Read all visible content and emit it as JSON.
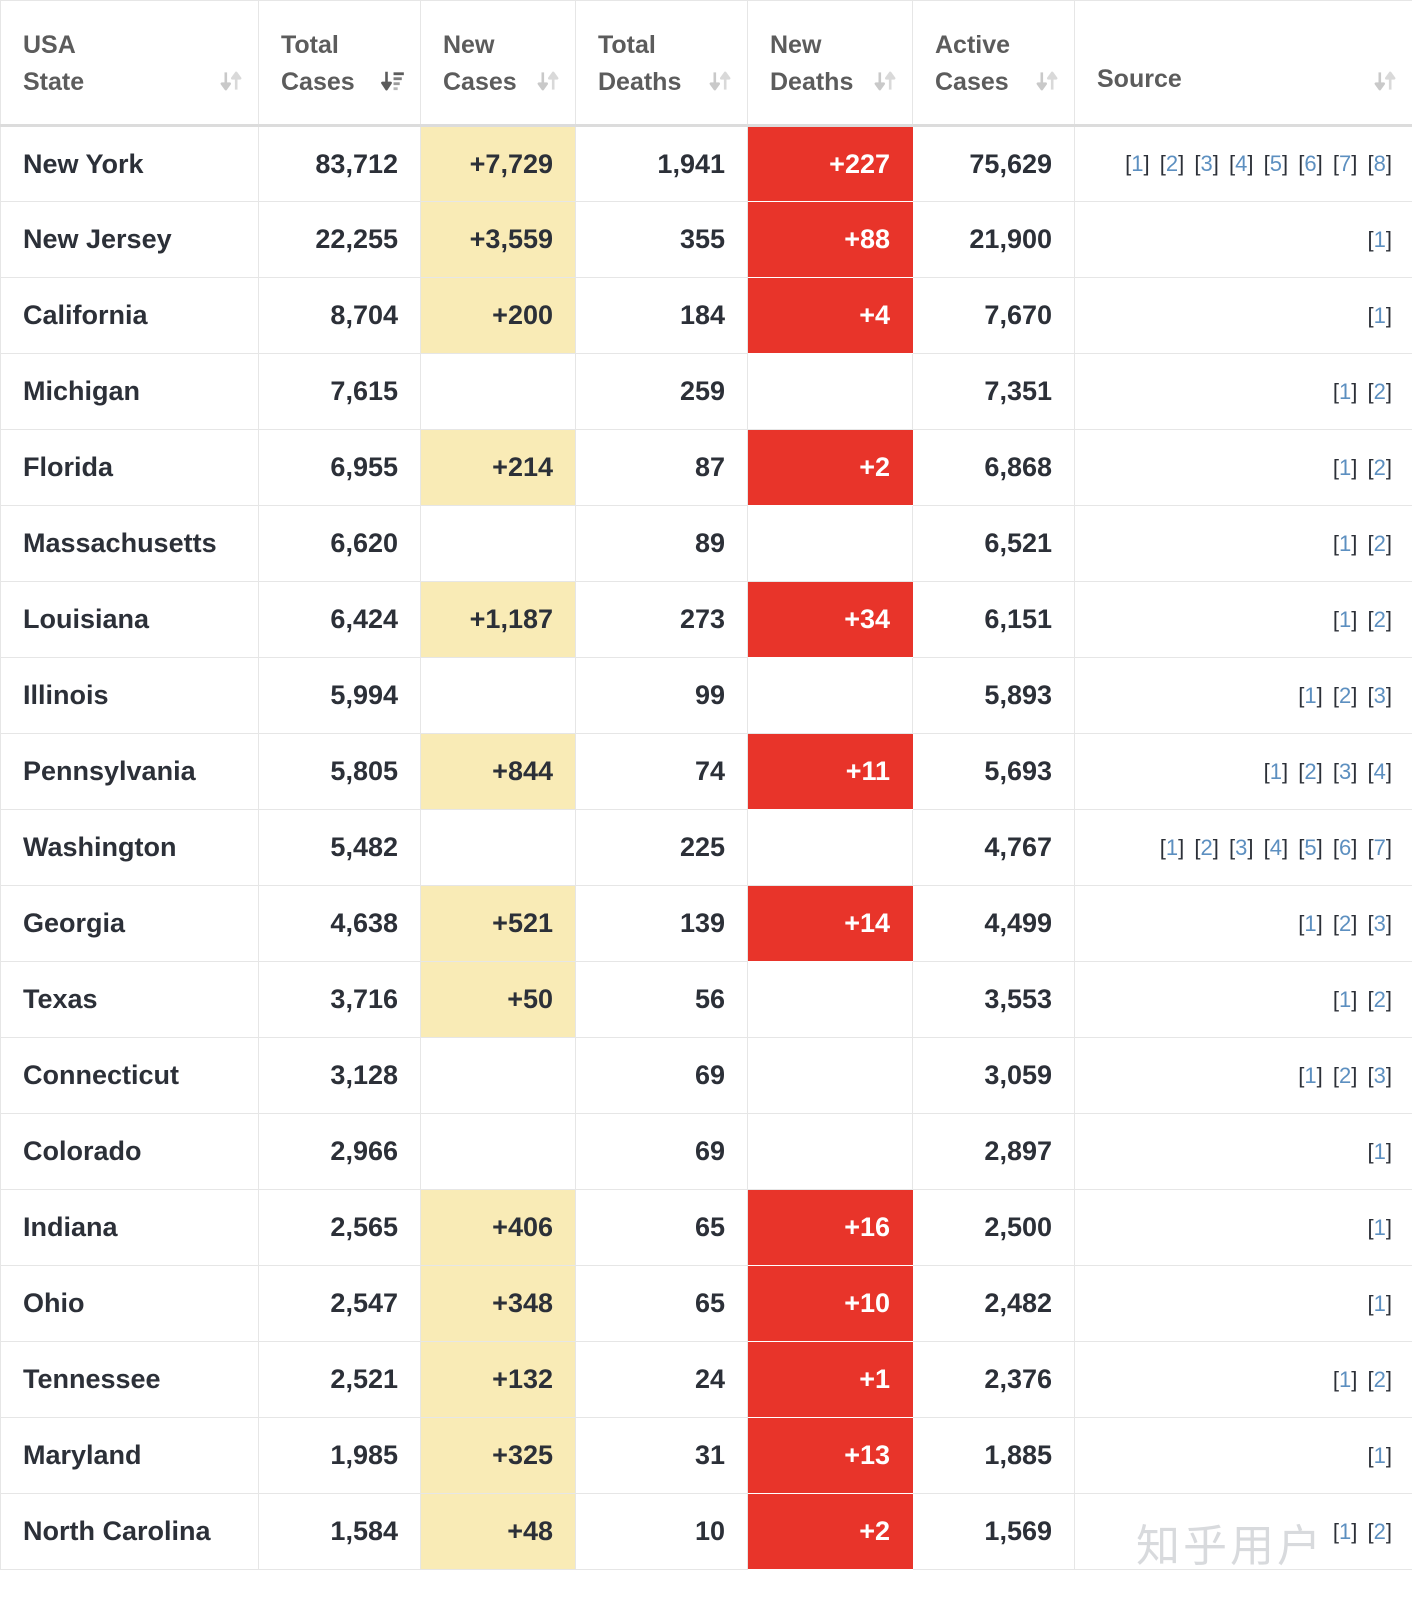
{
  "table": {
    "columns": [
      {
        "id": "state",
        "label_line1": "USA",
        "label_line2": "State",
        "sort_state": "none"
      },
      {
        "id": "total_cases",
        "label_line1": "Total",
        "label_line2": "Cases",
        "sort_state": "desc"
      },
      {
        "id": "new_cases",
        "label_line1": "New",
        "label_line2": "Cases",
        "sort_state": "none"
      },
      {
        "id": "total_deaths",
        "label_line1": "Total",
        "label_line2": "Deaths",
        "sort_state": "none"
      },
      {
        "id": "new_deaths",
        "label_line1": "New",
        "label_line2": "Deaths",
        "sort_state": "none"
      },
      {
        "id": "active_cases",
        "label_line1": "Active",
        "label_line2": "Cases",
        "sort_state": "none"
      },
      {
        "id": "source",
        "label_line1": "",
        "label_line2": "Source",
        "sort_state": "none"
      }
    ],
    "rows": [
      {
        "state": "New York",
        "total_cases": "83,712",
        "new_cases": "+7,729",
        "total_deaths": "1,941",
        "new_deaths": "+227",
        "active_cases": "75,629",
        "sources": [
          "1",
          "2",
          "3",
          "4",
          "5",
          "6",
          "7",
          "8"
        ]
      },
      {
        "state": "New Jersey",
        "total_cases": "22,255",
        "new_cases": "+3,559",
        "total_deaths": "355",
        "new_deaths": "+88",
        "active_cases": "21,900",
        "sources": [
          "1"
        ]
      },
      {
        "state": "California",
        "total_cases": "8,704",
        "new_cases": "+200",
        "total_deaths": "184",
        "new_deaths": "+4",
        "active_cases": "7,670",
        "sources": [
          "1"
        ]
      },
      {
        "state": "Michigan",
        "total_cases": "7,615",
        "new_cases": "",
        "total_deaths": "259",
        "new_deaths": "",
        "active_cases": "7,351",
        "sources": [
          "1",
          "2"
        ]
      },
      {
        "state": "Florida",
        "total_cases": "6,955",
        "new_cases": "+214",
        "total_deaths": "87",
        "new_deaths": "+2",
        "active_cases": "6,868",
        "sources": [
          "1",
          "2"
        ]
      },
      {
        "state": "Massachusetts",
        "total_cases": "6,620",
        "new_cases": "",
        "total_deaths": "89",
        "new_deaths": "",
        "active_cases": "6,521",
        "sources": [
          "1",
          "2"
        ]
      },
      {
        "state": "Louisiana",
        "total_cases": "6,424",
        "new_cases": "+1,187",
        "total_deaths": "273",
        "new_deaths": "+34",
        "active_cases": "6,151",
        "sources": [
          "1",
          "2"
        ]
      },
      {
        "state": "Illinois",
        "total_cases": "5,994",
        "new_cases": "",
        "total_deaths": "99",
        "new_deaths": "",
        "active_cases": "5,893",
        "sources": [
          "1",
          "2",
          "3"
        ]
      },
      {
        "state": "Pennsylvania",
        "total_cases": "5,805",
        "new_cases": "+844",
        "total_deaths": "74",
        "new_deaths": "+11",
        "active_cases": "5,693",
        "sources": [
          "1",
          "2",
          "3",
          "4"
        ]
      },
      {
        "state": "Washington",
        "total_cases": "5,482",
        "new_cases": "",
        "total_deaths": "225",
        "new_deaths": "",
        "active_cases": "4,767",
        "sources": [
          "1",
          "2",
          "3",
          "4",
          "5",
          "6",
          "7"
        ]
      },
      {
        "state": "Georgia",
        "total_cases": "4,638",
        "new_cases": "+521",
        "total_deaths": "139",
        "new_deaths": "+14",
        "active_cases": "4,499",
        "sources": [
          "1",
          "2",
          "3"
        ]
      },
      {
        "state": "Texas",
        "total_cases": "3,716",
        "new_cases": "+50",
        "total_deaths": "56",
        "new_deaths": "",
        "active_cases": "3,553",
        "sources": [
          "1",
          "2"
        ]
      },
      {
        "state": "Connecticut",
        "total_cases": "3,128",
        "new_cases": "",
        "total_deaths": "69",
        "new_deaths": "",
        "active_cases": "3,059",
        "sources": [
          "1",
          "2",
          "3"
        ]
      },
      {
        "state": "Colorado",
        "total_cases": "2,966",
        "new_cases": "",
        "total_deaths": "69",
        "new_deaths": "",
        "active_cases": "2,897",
        "sources": [
          "1"
        ]
      },
      {
        "state": "Indiana",
        "total_cases": "2,565",
        "new_cases": "+406",
        "total_deaths": "65",
        "new_deaths": "+16",
        "active_cases": "2,500",
        "sources": [
          "1"
        ]
      },
      {
        "state": "Ohio",
        "total_cases": "2,547",
        "new_cases": "+348",
        "total_deaths": "65",
        "new_deaths": "+10",
        "active_cases": "2,482",
        "sources": [
          "1"
        ]
      },
      {
        "state": "Tennessee",
        "total_cases": "2,521",
        "new_cases": "+132",
        "total_deaths": "24",
        "new_deaths": "+1",
        "active_cases": "2,376",
        "sources": [
          "1",
          "2"
        ]
      },
      {
        "state": "Maryland",
        "total_cases": "1,985",
        "new_cases": "+325",
        "total_deaths": "31",
        "new_deaths": "+13",
        "active_cases": "1,885",
        "sources": [
          "1"
        ]
      },
      {
        "state": "North Carolina",
        "total_cases": "1,584",
        "new_cases": "+48",
        "total_deaths": "10",
        "new_deaths": "+2",
        "active_cases": "1,569",
        "sources": [
          "1",
          "2"
        ]
      }
    ]
  },
  "watermark": {
    "text": "知乎用户"
  },
  "colors": {
    "new_cases_highlight": "#f9ebb6",
    "new_deaths_highlight": "#e8342a",
    "text_dark": "#2c3038",
    "header_text": "#5c5c5c",
    "ref_link": "#5c8fc0",
    "border": "#e6e6e6"
  }
}
